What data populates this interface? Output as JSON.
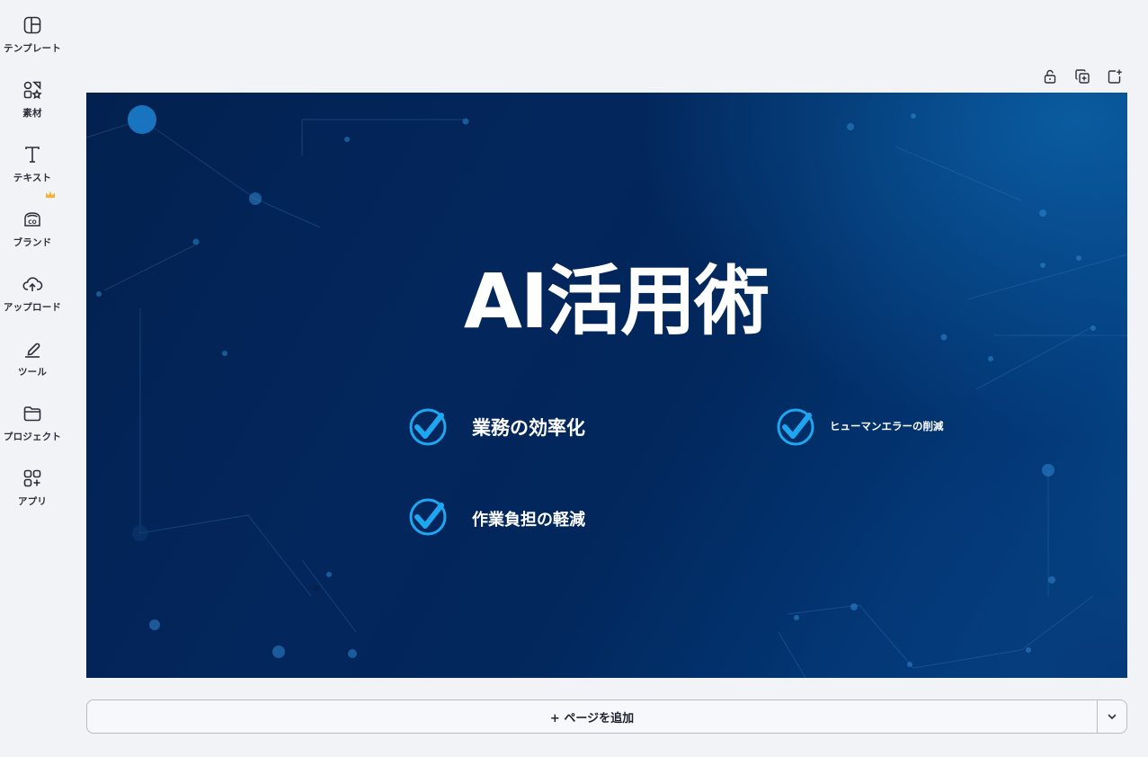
{
  "sidebar": {
    "items": [
      {
        "label": "テンプレート",
        "icon": "template-icon"
      },
      {
        "label": "素材",
        "icon": "elements-icon"
      },
      {
        "label": "テキスト",
        "icon": "text-icon"
      },
      {
        "label": "ブランド",
        "icon": "brand-icon"
      },
      {
        "label": "アップロード",
        "icon": "upload-icon"
      },
      {
        "label": "ツール",
        "icon": "tools-icon"
      },
      {
        "label": "プロジェクト",
        "icon": "folder-icon"
      },
      {
        "label": "アプリ",
        "icon": "apps-icon"
      }
    ]
  },
  "toolbar": {
    "icons": [
      "lock-icon",
      "duplicate-icon",
      "add-page-icon"
    ]
  },
  "slide": {
    "title": "AI活用術",
    "bullets": [
      "業務の効率化",
      "ヒューマンエラーの削減",
      "作業負担の軽減"
    ]
  },
  "footer": {
    "add_page_label": "+ ページを追加"
  },
  "colors": {
    "check_blue": "#1ea7f0",
    "slide_dark": "#02214f",
    "slide_accent": "#05508f",
    "crown": "#f3b23a"
  }
}
